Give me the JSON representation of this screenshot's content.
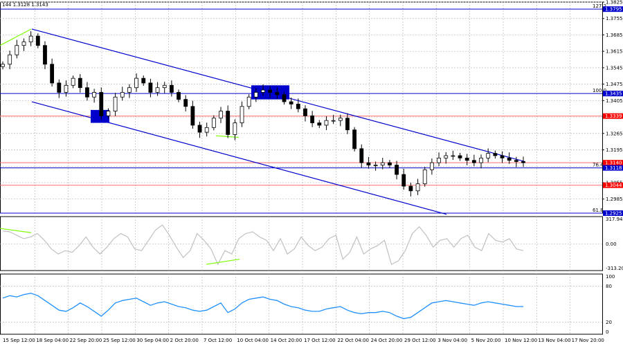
{
  "window": {
    "symbol_info": "144 1.3128 1.3143"
  },
  "chart_data": [
    {
      "type": "candlestick",
      "panel": "price",
      "ylim": [
        1.2925,
        1.3825
      ],
      "y_ticks": [
        1.3825,
        1.3755,
        1.3685,
        1.3615,
        1.3545,
        1.3475,
        1.3405,
        1.3335,
        1.3265,
        1.3195,
        1.3125,
        1.3055,
        1.2985
      ],
      "x_ticks": [
        "15 Sep 12:00",
        "18 Sep 04:00",
        "22 Sep 20:00",
        "25 Sep 12:00",
        "30 Sep 04:00",
        "2 Oct 20:00",
        "7 Oct 12:00",
        "10 Oct 04:00",
        "14 Oct 20:00",
        "17 Oct 12:00",
        "22 Oct 04:00",
        "24 Oct 20:00",
        "29 Oct 12:00",
        "3 Nov 04:00",
        "5 Nov 20:00",
        "10 Nov 12:00",
        "13 Nov 04:00",
        "17 Nov 20:00"
      ],
      "close_path": [
        1.356,
        1.36,
        1.364,
        1.3655,
        1.368,
        1.364,
        1.356,
        1.348,
        1.344,
        1.347,
        1.35,
        1.346,
        1.342,
        1.344,
        1.334,
        1.336,
        1.342,
        1.344,
        1.346,
        1.35,
        1.348,
        1.344,
        1.346,
        1.347,
        1.344,
        1.341,
        1.338,
        1.33,
        1.327,
        1.329,
        1.333,
        1.336,
        1.326,
        1.331,
        1.338,
        1.342,
        1.344,
        1.345,
        1.344,
        1.343,
        1.34,
        1.339,
        1.337,
        1.334,
        1.331,
        1.33,
        1.332,
        1.332,
        1.333,
        1.328,
        1.32,
        1.314,
        1.313,
        1.313,
        1.314,
        1.313,
        1.309,
        1.304,
        1.302,
        1.305,
        1.311,
        1.314,
        1.316,
        1.317,
        1.317,
        1.316,
        1.315,
        1.314,
        1.316,
        1.318,
        1.317,
        1.316,
        1.315,
        1.3145,
        1.314
      ],
      "levels": [
        {
          "name": "fib-127.2",
          "price": 1.3795,
          "tag": "1.3795",
          "label": "127.2",
          "color": "#0000cd",
          "tag_bg": "#0000cd",
          "tag_fg": "#ffffff"
        },
        {
          "name": "fib-100.0",
          "price": 1.3435,
          "tag": "1.3435",
          "label": "100.0",
          "color": "#0000cd",
          "tag_bg": "#0000cd",
          "tag_fg": "#ffffff"
        },
        {
          "name": "level-1.3339",
          "price": 1.3339,
          "tag": "1.3339",
          "label": "",
          "color": "#ff6f6f",
          "tag_bg": "#ff0000",
          "tag_fg": "#ffffff"
        },
        {
          "name": "current-price",
          "price": 1.314,
          "tag": "1.3140",
          "label": "",
          "color": "#ff6f6f",
          "tag_bg": "#ff0000",
          "tag_fg": "#ffffff"
        },
        {
          "name": "fib-76.4",
          "price": 1.3118,
          "tag": "1.3118",
          "label": "76.4",
          "color": "#0000cd",
          "tag_bg": "#0000cd",
          "tag_fg": "#ffffff"
        },
        {
          "name": "level-1.3044",
          "price": 1.3044,
          "tag": "1.3044",
          "label": "",
          "color": "#ff6f6f",
          "tag_bg": "#ff0000",
          "tag_fg": "#ffffff"
        },
        {
          "name": "fib-61.8",
          "price": 1.2925,
          "tag": "1.2925",
          "label": "61.8",
          "color": "#0000cd",
          "tag_bg": "#0000cd",
          "tag_fg": "#ffffff"
        }
      ],
      "channel_color": "#0000cd",
      "divergence_color": "#7cfc00",
      "highlight_color": "#0000cd"
    },
    {
      "type": "line",
      "panel": "cci",
      "y_ticks": [
        "317.9471",
        "0.00",
        "-313.204"
      ],
      "series": [
        {
          "values": [
            150,
            140,
            100,
            60,
            80,
            120,
            40,
            -60,
            -120,
            -80,
            -100,
            -20,
            80,
            -40,
            -120,
            -40,
            60,
            120,
            80,
            -60,
            -80,
            40,
            160,
            220,
            100,
            -40,
            -160,
            -80,
            120,
            40,
            -60,
            -240,
            -80,
            -120,
            60,
            120,
            140,
            80,
            40,
            -80,
            60,
            -120,
            -60,
            80,
            -20,
            -80,
            -40,
            60,
            100,
            -180,
            -100,
            80,
            -120,
            -60,
            -20,
            40,
            -240,
            -200,
            -80,
            120,
            200,
            100,
            -40,
            40,
            60,
            -40,
            60,
            100,
            -40,
            -80,
            120,
            40,
            20,
            60,
            -60,
            -80
          ],
          "color": "#c0c0c0"
        }
      ],
      "divergence_color": "#7cfc00"
    },
    {
      "type": "line",
      "panel": "rsi",
      "y_ticks": [
        "100",
        "80",
        "20",
        "0"
      ],
      "series": [
        {
          "values": [
            60,
            64,
            62,
            66,
            68,
            64,
            56,
            48,
            40,
            38,
            44,
            52,
            46,
            38,
            30,
            40,
            52,
            56,
            58,
            60,
            54,
            48,
            52,
            54,
            50,
            46,
            44,
            40,
            38,
            40,
            46,
            52,
            36,
            42,
            52,
            58,
            60,
            62,
            58,
            56,
            50,
            46,
            44,
            40,
            38,
            38,
            42,
            44,
            46,
            40,
            36,
            34,
            36,
            36,
            38,
            36,
            30,
            26,
            28,
            36,
            44,
            52,
            54,
            56,
            54,
            52,
            50,
            48,
            52,
            54,
            52,
            50,
            48,
            46,
            46
          ],
          "color": "#1e90ff"
        }
      ]
    }
  ]
}
